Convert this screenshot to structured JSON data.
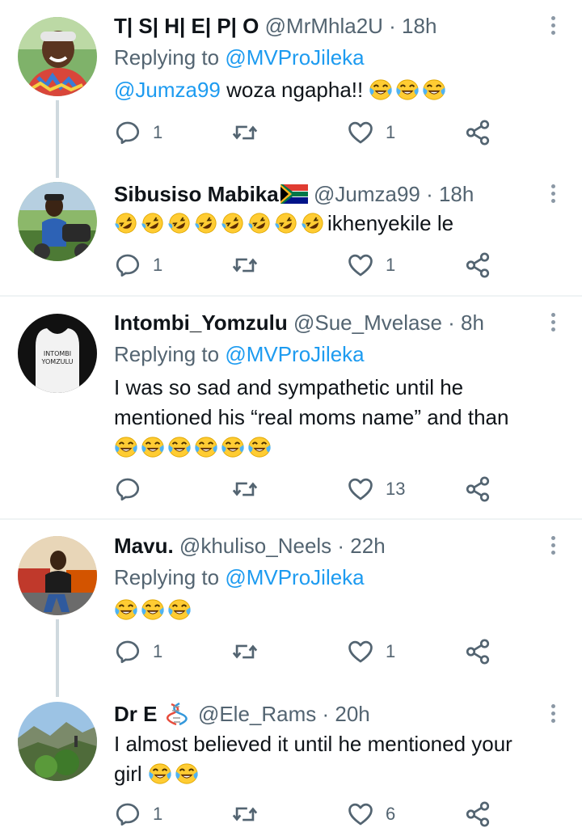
{
  "tweets": [
    {
      "name": "T| S| H| E| P| O",
      "handle": "@MrMhla2U · 18h",
      "replying_prefix": "Replying to ",
      "replying_to": "@MVProJileka",
      "mention": "@Jumza99",
      "text": " woza ngapha!! ",
      "emojis": 3,
      "replies": "1",
      "likes": "1"
    },
    {
      "name": "Sibusiso Mabika",
      "flag": "south-africa-flag",
      "handle": "@Jumza99 · 18h",
      "emojis": 8,
      "text": "ikhenyekile le",
      "replies": "1",
      "likes": "1"
    },
    {
      "name": "Intombi_Yomzulu",
      "handle": "@Sue_Mvelase · 8h",
      "replying_prefix": "Replying to ",
      "replying_to": "@MVProJileka",
      "text": "I was so sad and sympathetic until he mentioned his “real moms name” and than",
      "emojis": 6,
      "replies": "",
      "likes": "13",
      "avatar_text": "INTOMBI YOMZULU"
    },
    {
      "name": "Mavu.",
      "handle": "@khuliso_Neels · 22h",
      "replying_prefix": "Replying to ",
      "replying_to": "@MVProJileka",
      "emojis": 3,
      "replies": "1",
      "likes": "1"
    },
    {
      "name": "Dr E",
      "badge": "dna-emoji",
      "handle": "@Ele_Rams · 20h",
      "text": "I almost believed it until he mentioned your girl",
      "emojis": 2,
      "replies": "1",
      "likes": "6"
    }
  ],
  "colors": {
    "link": "#1d9bf0",
    "secondary": "#536471",
    "thread_line": "#cfd9de",
    "divider": "#eff3f4"
  }
}
